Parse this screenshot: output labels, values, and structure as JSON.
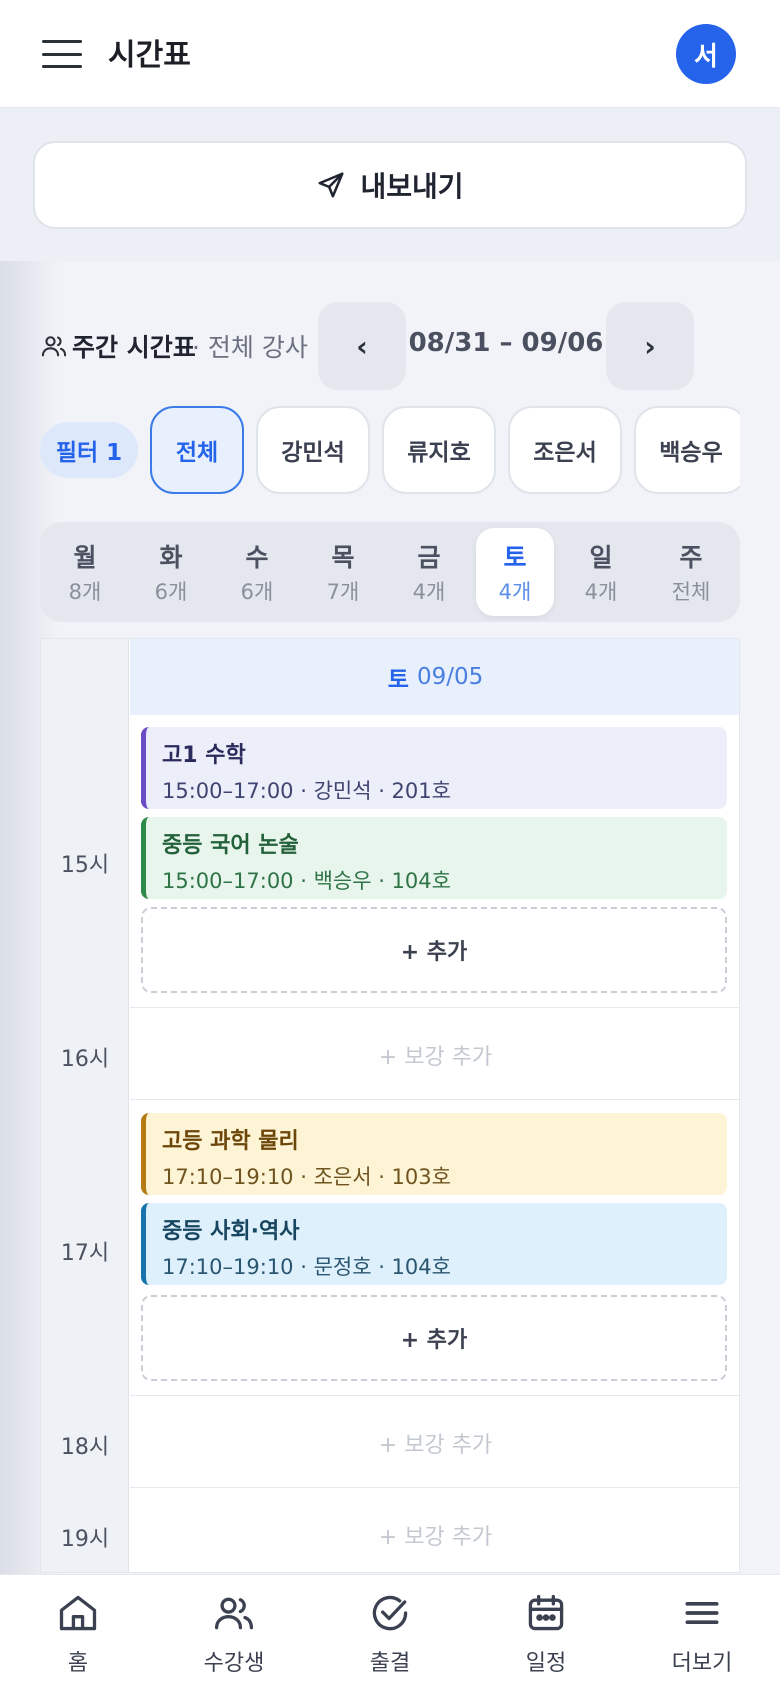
{
  "header": {
    "title": "시간표",
    "avatar_text": "서"
  },
  "export": {
    "label": "내보내기"
  },
  "week": {
    "title": "주간 시간표",
    "subtitle": "· 전체 강사",
    "prev": "‹",
    "next": "›",
    "range": "08/31 – 09/06"
  },
  "filters": {
    "filter_label": "필터 1",
    "chips": [
      "전체",
      "강민석",
      "류지호",
      "조은서",
      "백승우"
    ]
  },
  "days": [
    {
      "day": "월",
      "count": "8개"
    },
    {
      "day": "화",
      "count": "6개"
    },
    {
      "day": "수",
      "count": "6개"
    },
    {
      "day": "목",
      "count": "7개"
    },
    {
      "day": "금",
      "count": "4개"
    },
    {
      "day": "토",
      "count": "4개"
    },
    {
      "day": "일",
      "count": "4개"
    },
    {
      "day": "주",
      "count": "전체"
    }
  ],
  "selected_day": {
    "weekday": "토",
    "date": "09/05"
  },
  "hours": [
    "15시",
    "16시",
    "17시",
    "18시",
    "19시"
  ],
  "classes": [
    {
      "title": "고1 수학",
      "meta": "15:00–17:00 · 강민석 · 201호"
    },
    {
      "title": "중등 국어 논술",
      "meta": "15:00–17:00 · 백승우 · 104호"
    },
    {
      "title": "고등 과학 물리",
      "meta": "17:10–19:10 · 조은서 · 103호"
    },
    {
      "title": "중등 사회·역사",
      "meta": "17:10–19:10 · 문정호 · 104호"
    }
  ],
  "add_label": "+ 추가",
  "makeup_label": "+ 보강 추가",
  "bottom_nav": [
    "홈",
    "수강생",
    "출결",
    "일정",
    "더보기"
  ],
  "colors": {
    "accent": "#2563eb",
    "purple": "#6a4cc7",
    "green": "#2e8a4a",
    "yellow": "#b67a14",
    "blue": "#1673ab"
  }
}
